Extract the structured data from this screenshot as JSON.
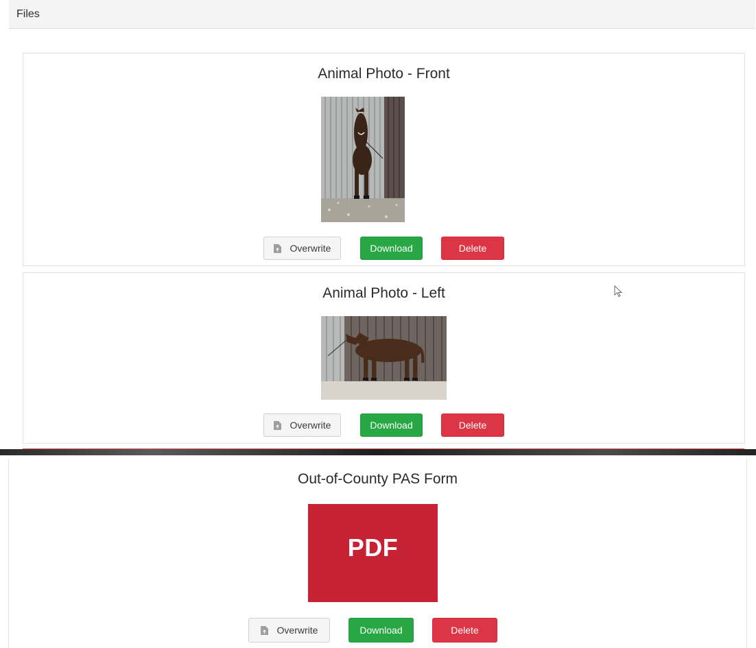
{
  "header": {
    "title": "Files"
  },
  "buttons": {
    "overwrite": "Overwrite",
    "download": "Download",
    "delete": "Delete"
  },
  "files": [
    {
      "title": "Animal Photo - Front",
      "kind": "image"
    },
    {
      "title": "Animal Photo - Left",
      "kind": "image"
    },
    {
      "title": "Out-of-County PAS Form",
      "kind": "pdf",
      "thumb_label": "PDF"
    }
  ],
  "colors": {
    "download": "#28a745",
    "delete": "#dc3545",
    "pdf": "#c62233",
    "header_bg": "#f4f4f4"
  },
  "icons": {
    "overwrite": "file-upload-icon",
    "cursor": "mouse-pointer-icon"
  }
}
